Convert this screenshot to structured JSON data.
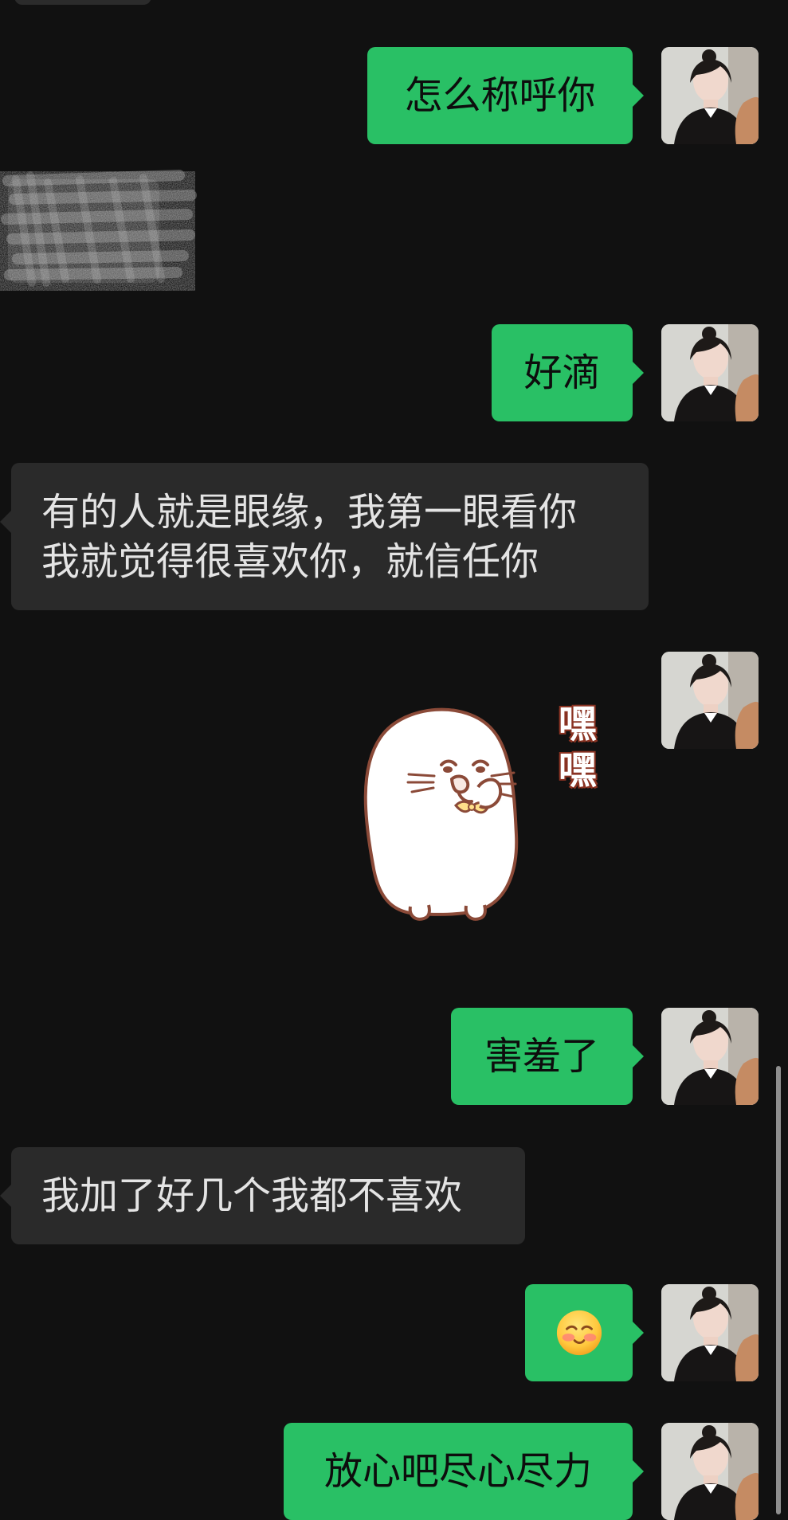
{
  "messages": {
    "m1": "怎么称呼你",
    "m3": "好滴",
    "m4_line1": "有的人就是眼缘，我第一眼看你",
    "m4_line2": "我就觉得很喜欢你，就信任你",
    "m5_sticker_line1": "嘿",
    "m5_sticker_line2": "嘿",
    "m6": "害羞了",
    "m7": "我加了好几个我都不喜欢",
    "m8_emoji": "blushing-emoji",
    "m9": "放心吧尽心尽力"
  },
  "colors": {
    "background": "#111111",
    "outgoing_bubble": "#29c065",
    "incoming_bubble": "#2a2a2a",
    "incoming_text": "#e4e4e4",
    "outgoing_text": "#0d0d0d"
  },
  "icons": {
    "avatar": "profile-avatar",
    "sticker": "blushing-seal-sticker",
    "emoji": "blushing-emoji",
    "scrollbar": "vertical-scrollbar"
  }
}
